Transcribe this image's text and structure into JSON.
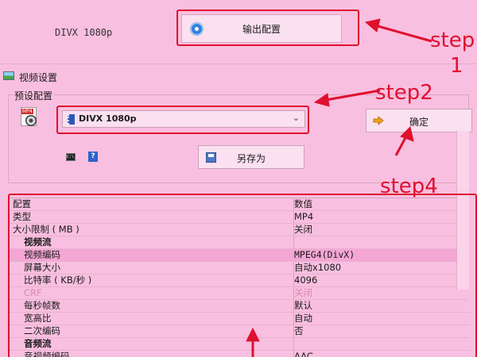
{
  "background_window": {
    "profile_name": "DIVX 1080p",
    "output_button_label": "输出配置"
  },
  "dialog": {
    "title": "视频设置",
    "preset_group_label": "预设配置",
    "preset_select_value": "DIVX 1080p",
    "ok_button_label": "确定",
    "save_as_button_label": "另存为",
    "help_icon_glyph": "?"
  },
  "grid": {
    "header": {
      "name": "配置",
      "value": "数值"
    },
    "rows": [
      {
        "name": "类型",
        "value": "MP4"
      },
      {
        "name": "大小限制 ( MB )",
        "value": "关闭"
      },
      {
        "name": "视频流",
        "value": ""
      },
      {
        "name": "视频编码",
        "value": "MPEG4(DivX)"
      },
      {
        "name": "屏幕大小",
        "value": "自动x1080"
      },
      {
        "name": "比特率 ( KB/秒 )",
        "value": "4096"
      },
      {
        "name": "CRF",
        "value": "关闭"
      },
      {
        "name": "每秒帧数",
        "value": "默认"
      },
      {
        "name": "宽高比",
        "value": "自动"
      },
      {
        "name": "二次编码",
        "value": "否"
      },
      {
        "name": "音频流",
        "value": ""
      },
      {
        "name": "音视频编码",
        "value": "AAC"
      }
    ]
  },
  "annotations": {
    "step1_line1": "step",
    "step1_line2": "1",
    "step2": "step2",
    "step4": "step4"
  },
  "colors": {
    "background": "#f9bfe0",
    "annotation_red": "#e0102f",
    "highlight_row": "#f4a6d4"
  }
}
